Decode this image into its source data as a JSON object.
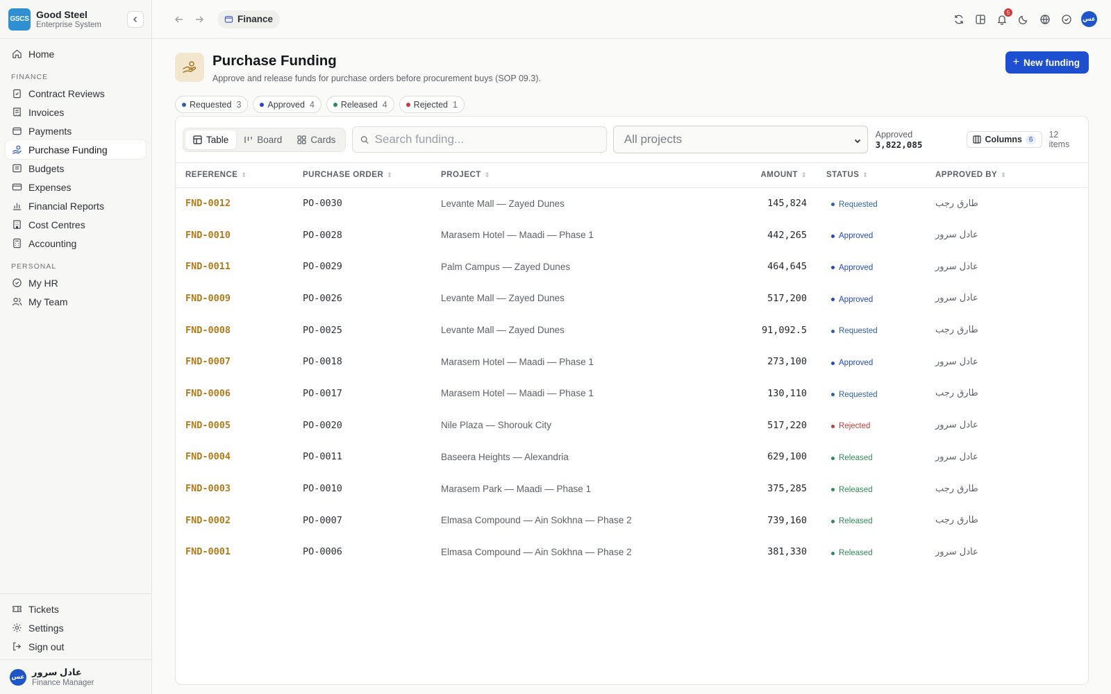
{
  "brand": {
    "logo": "GSCS",
    "name": "Good Steel",
    "subtitle": "Enterprise System"
  },
  "sidebar": {
    "home": "Home",
    "section_finance": "FINANCE",
    "finance_items": [
      {
        "label": "Contract Reviews",
        "icon": "clipboard-check-icon"
      },
      {
        "label": "Invoices",
        "icon": "receipt-icon"
      },
      {
        "label": "Payments",
        "icon": "wallet-icon"
      },
      {
        "label": "Purchase Funding",
        "icon": "hand-coins-icon"
      },
      {
        "label": "Budgets",
        "icon": "folder-icon"
      },
      {
        "label": "Expenses",
        "icon": "card-icon"
      },
      {
        "label": "Financial Reports",
        "icon": "bar-chart-icon"
      },
      {
        "label": "Cost Centres",
        "icon": "building-icon"
      },
      {
        "label": "Accounting",
        "icon": "calculator-icon"
      }
    ],
    "section_personal": "PERSONAL",
    "personal_items": [
      {
        "label": "My HR",
        "icon": "check-circle-icon"
      },
      {
        "label": "My Team",
        "icon": "users-icon"
      }
    ],
    "bottom_items": [
      {
        "label": "Tickets",
        "icon": "ticket-icon"
      },
      {
        "label": "Settings",
        "icon": "gear-icon"
      },
      {
        "label": "Sign out",
        "icon": "sign-out-icon"
      }
    ],
    "user": {
      "avatar": "عس",
      "name": "عادل سرور",
      "role": "Finance Manager"
    }
  },
  "topbar": {
    "breadcrumb": "Finance",
    "notification_count": "5",
    "avatar": "عس"
  },
  "page": {
    "title": "Purchase Funding",
    "subtitle": "Approve and release funds for purchase orders before procurement buys (SOP 09.3).",
    "new_button": "New funding"
  },
  "filters": [
    {
      "label": "Requested",
      "count": "3",
      "color": "#2f5fa8"
    },
    {
      "label": "Approved",
      "count": "4",
      "color": "#2446c9"
    },
    {
      "label": "Released",
      "count": "4",
      "color": "#2e8b57"
    },
    {
      "label": "Rejected",
      "count": "1",
      "color": "#c23b3b"
    }
  ],
  "toolbar": {
    "views": [
      "Table",
      "Board",
      "Cards"
    ],
    "search_placeholder": "Search funding...",
    "project_select": "All projects",
    "approved_label": "Approved",
    "approved_total": "3,822,085",
    "columns_label": "Columns",
    "columns_count": "6",
    "items_count": "12 items"
  },
  "table": {
    "headers": [
      "REFERENCE",
      "PURCHASE ORDER",
      "PROJECT",
      "AMOUNT",
      "STATUS",
      "APPROVED BY"
    ],
    "rows": [
      {
        "ref": "FND-0012",
        "po": "PO-0030",
        "project": "Levante Mall — Zayed Dunes",
        "amount": "145,824",
        "status": "Requested",
        "by": "طارق رجب"
      },
      {
        "ref": "FND-0010",
        "po": "PO-0028",
        "project": "Marasem Hotel — Maadi — Phase 1",
        "amount": "442,265",
        "status": "Approved",
        "by": "عادل سرور"
      },
      {
        "ref": "FND-0011",
        "po": "PO-0029",
        "project": "Palm Campus — Zayed Dunes",
        "amount": "464,645",
        "status": "Approved",
        "by": "عادل سرور"
      },
      {
        "ref": "FND-0009",
        "po": "PO-0026",
        "project": "Levante Mall — Zayed Dunes",
        "amount": "517,200",
        "status": "Approved",
        "by": "عادل سرور"
      },
      {
        "ref": "FND-0008",
        "po": "PO-0025",
        "project": "Levante Mall — Zayed Dunes",
        "amount": "91,092.5",
        "status": "Requested",
        "by": "طارق رجب"
      },
      {
        "ref": "FND-0007",
        "po": "PO-0018",
        "project": "Marasem Hotel — Maadi — Phase 1",
        "amount": "273,100",
        "status": "Approved",
        "by": "عادل سرور"
      },
      {
        "ref": "FND-0006",
        "po": "PO-0017",
        "project": "Marasem Hotel — Maadi — Phase 1",
        "amount": "130,110",
        "status": "Requested",
        "by": "طارق رجب"
      },
      {
        "ref": "FND-0005",
        "po": "PO-0020",
        "project": "Nile Plaza — Shorouk City",
        "amount": "517,220",
        "status": "Rejected",
        "by": "عادل سرور"
      },
      {
        "ref": "FND-0004",
        "po": "PO-0011",
        "project": "Baseera Heights — Alexandria",
        "amount": "629,100",
        "status": "Released",
        "by": "عادل سرور"
      },
      {
        "ref": "FND-0003",
        "po": "PO-0010",
        "project": "Marasem Park — Maadi — Phase 1",
        "amount": "375,285",
        "status": "Released",
        "by": "طارق رجب"
      },
      {
        "ref": "FND-0002",
        "po": "PO-0007",
        "project": "Elmasa Compound — Ain Sokhna — Phase 2",
        "amount": "739,160",
        "status": "Released",
        "by": "طارق رجب"
      },
      {
        "ref": "FND-0001",
        "po": "PO-0006",
        "project": "Elmasa Compound — Ain Sokhna — Phase 2",
        "amount": "381,330",
        "status": "Released",
        "by": "عادل سرور"
      }
    ]
  },
  "status_colors": {
    "Requested": "#2f5fa8",
    "Approved": "#2446c9",
    "Released": "#2e8b57",
    "Rejected": "#c23b3b"
  }
}
